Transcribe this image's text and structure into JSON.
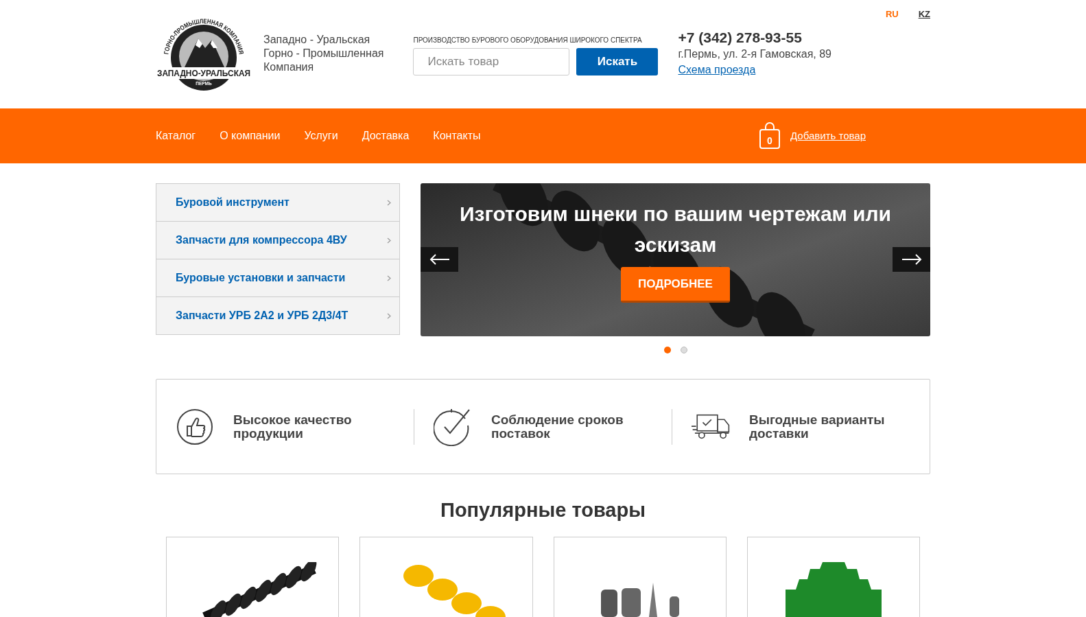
{
  "logo": {
    "arc_text": "ГОРНО-ПРОМЫШЛЕННАЯ КОМПАНИЯ",
    "band_text": "ЗАПАДНО-УРАЛЬСКАЯ",
    "city": "ПЕРМЬ"
  },
  "company_name": [
    "Западно - Уральская",
    "Горно - Промышленная",
    "Компания"
  ],
  "search": {
    "caption": "ПРОИЗВОДСТВО БУРОВОГО ОБОРУДОВАНИЯ ШИРОКОГО СПЕКТРА",
    "placeholder": "Искать товар",
    "button": "Искать"
  },
  "languages": [
    {
      "label": "RU",
      "selected": true
    },
    {
      "label": "KZ",
      "selected": false
    }
  ],
  "contacts": {
    "phone": "+7 (342) 278-93-55",
    "address": "г.Пермь, ул. 2-я Гамовская, 89",
    "map_link": "Схема проезда"
  },
  "nav": [
    "Каталог",
    "О компании",
    "Услуги",
    "Доставка",
    "Контакты"
  ],
  "cart": {
    "count": "0",
    "link": "Добавить товар"
  },
  "sidebar": {
    "items": [
      "Буровой инструмент",
      "Запчасти для компрессора 4ВУ",
      "Буровые установки и запчасти",
      "Запчасти УРБ 2А2 и УРБ 2Д3/4Т"
    ]
  },
  "slider": {
    "heading": "Изготовим шнеки по вашим чертежам или эскизам",
    "button": "ПОДРОБНЕЕ",
    "dots": [
      {
        "selected": true
      },
      {
        "selected": false
      }
    ]
  },
  "features": [
    {
      "kind": "quality",
      "text": "Высокое качество продукции"
    },
    {
      "kind": "time",
      "text": "Соблюдение сроков поставок"
    },
    {
      "kind": "delivery",
      "text": "Выгодные варианты доставки"
    }
  ],
  "popular": {
    "title": "Популярные товары",
    "products": [
      {
        "kind": "auger-black"
      },
      {
        "kind": "auger-yellow"
      },
      {
        "kind": "bits"
      },
      {
        "kind": "crown"
      }
    ]
  }
}
